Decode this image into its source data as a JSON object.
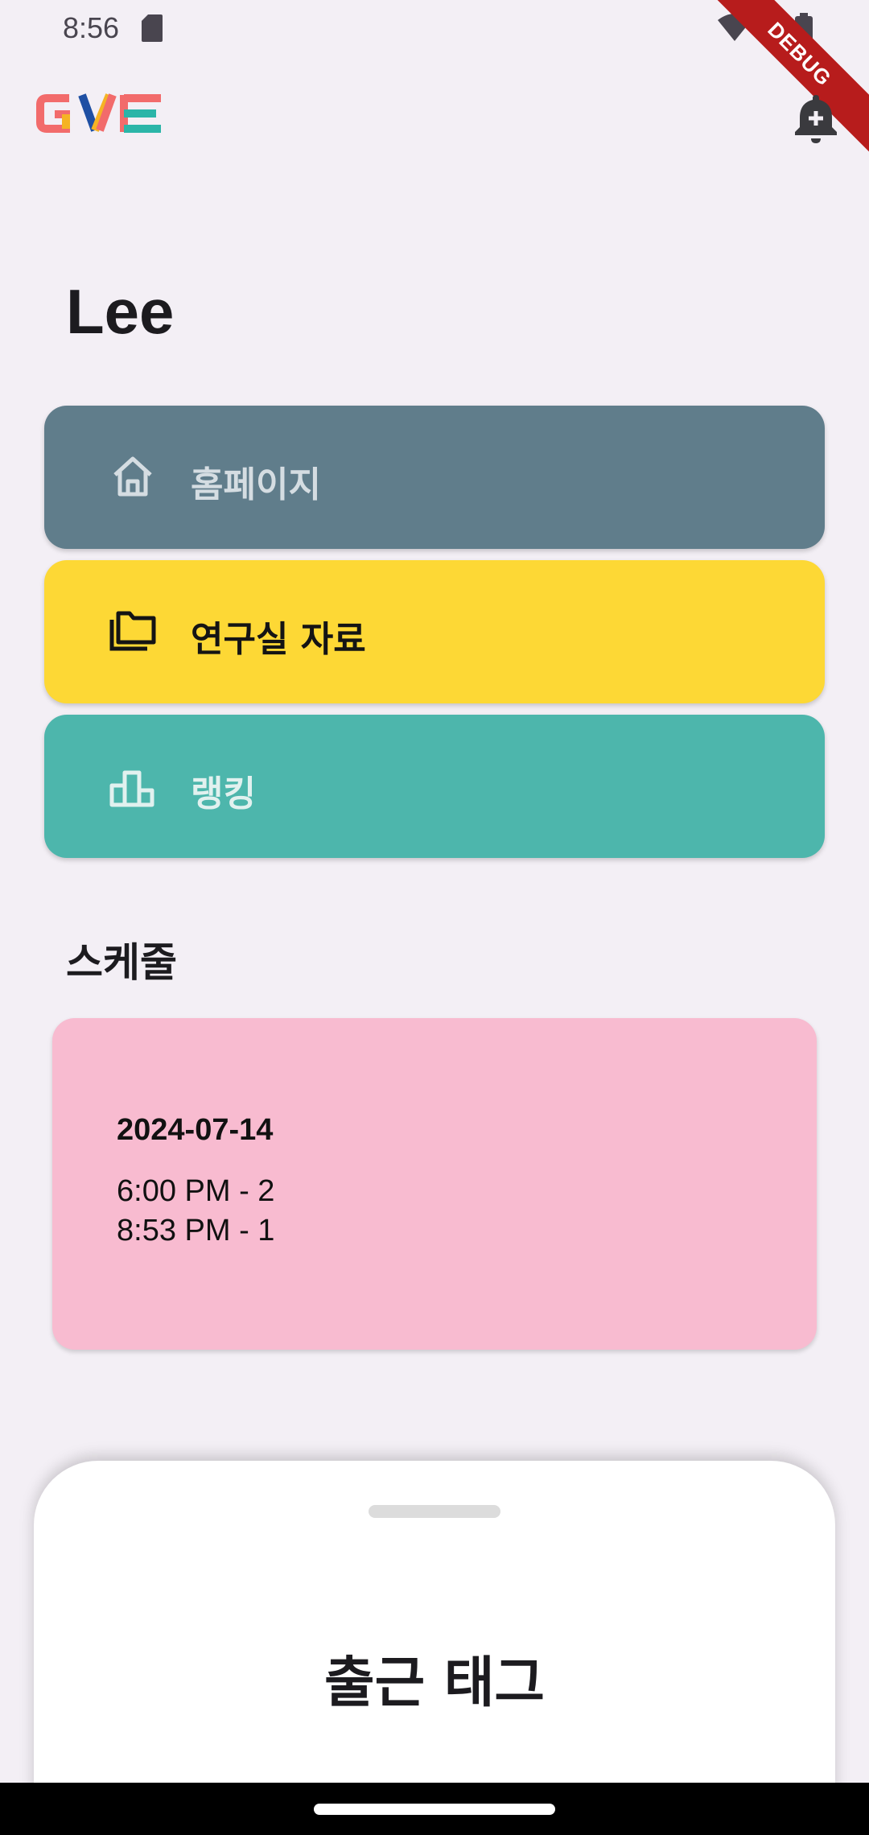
{
  "status_bar": {
    "time": "8:56",
    "debug_label": "DEBUG",
    "icons": [
      "sd-card-icon",
      "wifi-icon",
      "cellular-icon",
      "battery-icon"
    ]
  },
  "header": {
    "logo_text": "GVE",
    "logo_colors": [
      "#f26b6b",
      "#f5b324",
      "#1e4fa3",
      "#2bb5a8"
    ],
    "notification_icon": "notification-add-icon"
  },
  "user": {
    "name": "Lee"
  },
  "menu": [
    {
      "label": "홈페이지",
      "icon": "home-icon",
      "color": "#607d8b"
    },
    {
      "label": "연구실 자료",
      "icon": "folder-icon",
      "color": "#fdd835"
    },
    {
      "label": "랭킹",
      "icon": "leaderboard-icon",
      "color": "#4db6ac"
    }
  ],
  "schedule": {
    "title": "스케줄",
    "date": "2024-07-14",
    "entries": [
      "6:00 PM - 2",
      "8:53 PM - 1"
    ],
    "card_color": "#f8bbd0"
  },
  "bottom_sheet": {
    "title": "출근 태그"
  }
}
